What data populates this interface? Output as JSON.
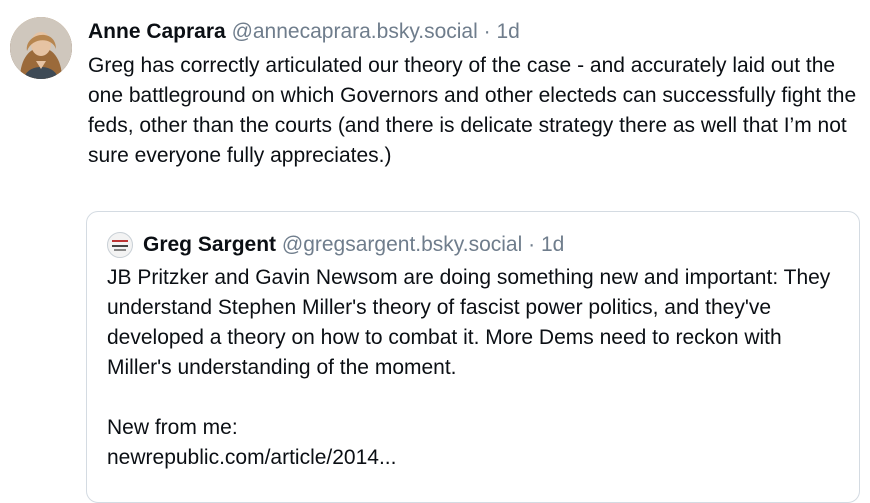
{
  "post": {
    "author_name": "Anne Caprara",
    "handle": "@annecaprara.bsky.social",
    "separator": "·",
    "age": "1d",
    "text": "Greg has correctly articulated our theory of the case - and accurately laid out the one battleground on which Governors and other electeds can successfully fight the feds, other than the courts (and there is delicate strategy there as well that I’m not sure everyone fully appreciates.)"
  },
  "quote": {
    "author_name": "Greg Sargent",
    "handle": "@gregsargent.bsky.social",
    "separator": "·",
    "age": "1d",
    "text": "JB Pritzker and Gavin Newsom are doing something new and important: They understand Stephen Miller's theory of fascist power politics, and they've developed a theory on how to combat it. More Dems need to reckon with Miller's understanding of the moment.",
    "text2": "New from me:",
    "link": "newrepublic.com/article/2014..."
  }
}
